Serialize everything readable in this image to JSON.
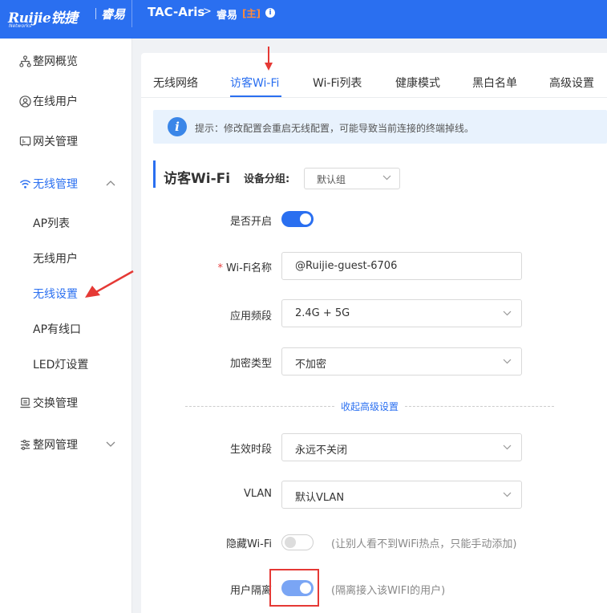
{
  "header": {
    "brand": "Ruijie锐捷",
    "brand_sub": "Networks",
    "brand_cn": "睿易",
    "device": "TAC-Aris",
    "crumb_arrow": ">",
    "crumb_name": "睿易",
    "crumb_tag": "[主]",
    "info_icon": "i",
    "bg_color": "#2a6ff0"
  },
  "sidebar": {
    "overview": "整网概览",
    "online_users": "在线用户",
    "gateway": "网关管理",
    "wireless": "无线管理",
    "sub": {
      "ap_list": "AP列表",
      "wireless_users": "无线用户",
      "wireless_settings": "无线设置",
      "ap_wired": "AP有线口",
      "led": "LED灯设置"
    },
    "switch": "交换管理",
    "network": "整网管理"
  },
  "tabs": [
    "无线网络",
    "访客Wi-Fi",
    "Wi-Fi列表",
    "健康模式",
    "黑白名单",
    "高级设置"
  ],
  "notice": {
    "icon": "i",
    "text": "提示：修改配置会重启无线配置，可能导致当前连接的终端掉线。"
  },
  "section": {
    "title": "访客Wi-Fi",
    "group_label": "设备分组:",
    "group_value": "默认组"
  },
  "form": {
    "enable_label": "是否开启",
    "enable_on": true,
    "required_mark": "*",
    "ssid_label": "Wi-Fi名称",
    "ssid_value": "@Ruijie-guest-6706",
    "band_label": "应用频段",
    "band_value": "2.4G + 5G",
    "encrypt_label": "加密类型",
    "encrypt_value": "不加密",
    "collapse_link": "收起高级设置",
    "period_label": "生效时段",
    "period_value": "永远不关闭",
    "vlan_label": "VLAN",
    "vlan_value": "默认VLAN",
    "hidden_label": "隐藏Wi-Fi",
    "hidden_on": false,
    "hidden_hint": "(让别人看不到WiFi热点，只能手动添加)",
    "isolation_label": "用户隔离",
    "isolation_on": true,
    "isolation_hint": "(隔离接入该WIFI的用户)"
  },
  "colors": {
    "accent": "#2a6ff0",
    "annotation_red": "#e53935"
  }
}
